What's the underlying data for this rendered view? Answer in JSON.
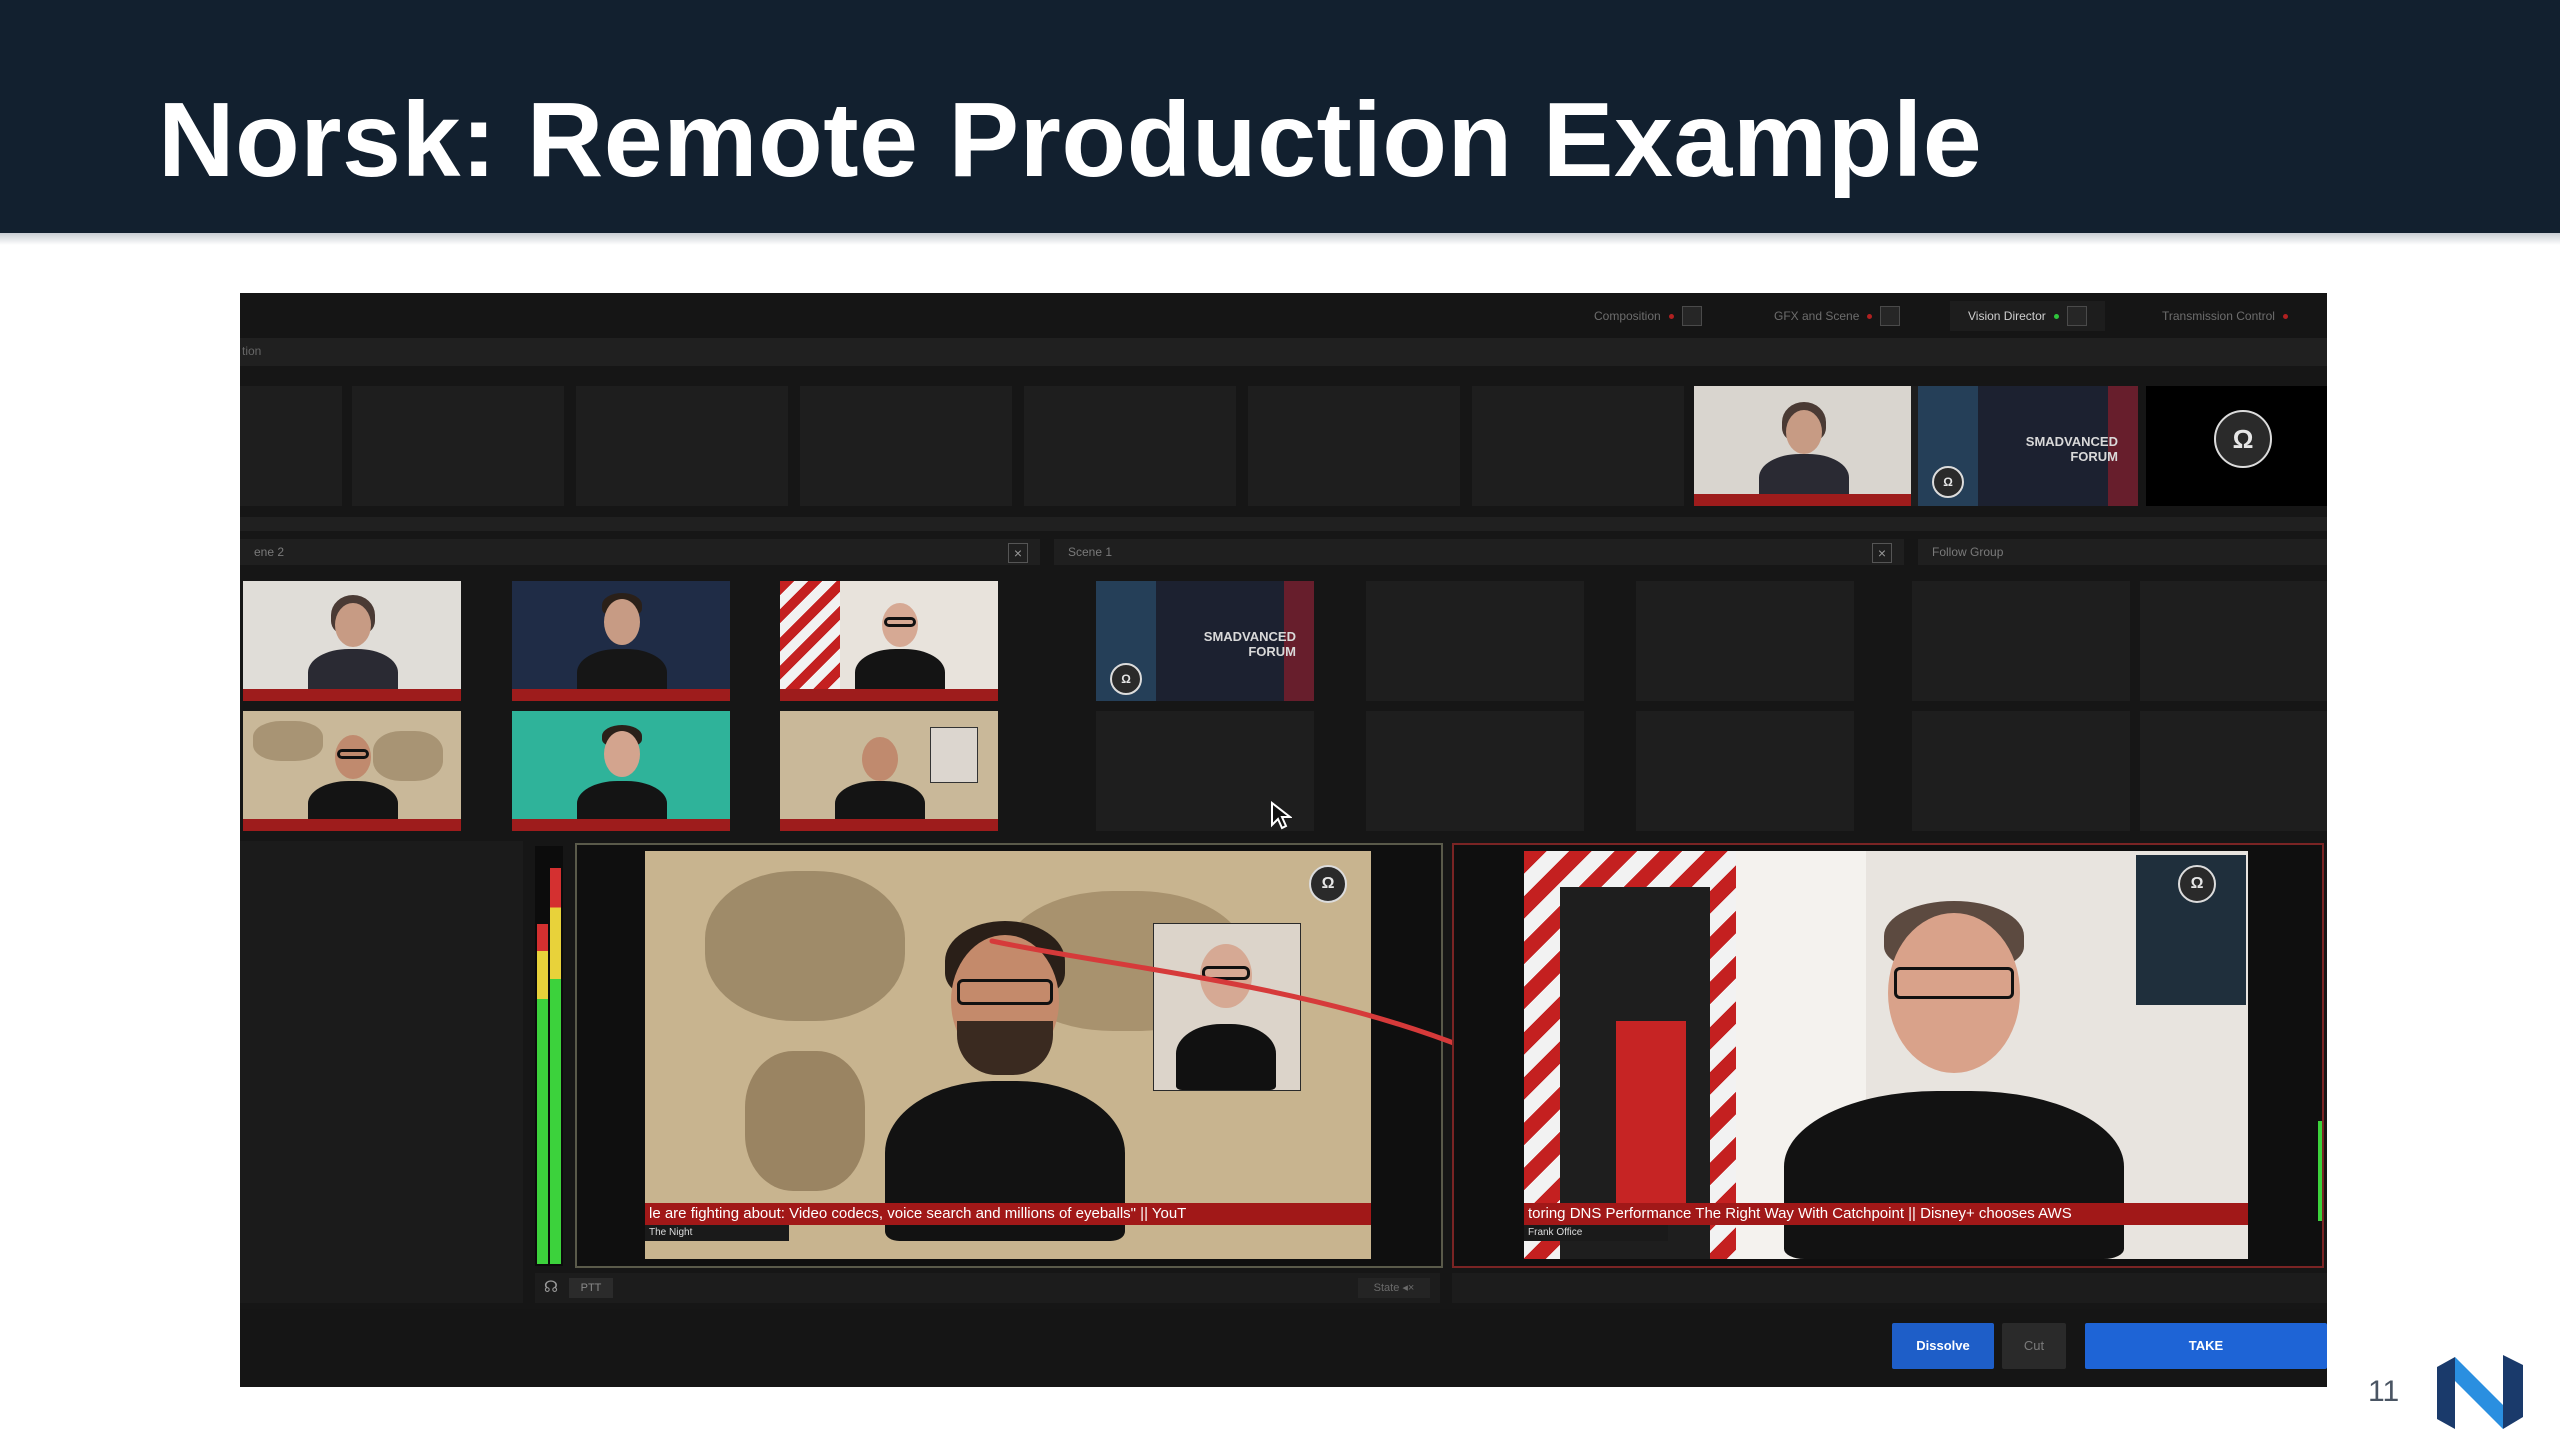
{
  "slide": {
    "title": "Norsk: Remote Production Example",
    "page_number": "11"
  },
  "app": {
    "tabs": [
      {
        "label": "Composition",
        "active": false
      },
      {
        "label": "GFX and Scene",
        "active": false
      },
      {
        "label": "Vision Director",
        "active": true
      },
      {
        "label": "Transmission Control",
        "active": false
      }
    ],
    "strip_label": "tion",
    "panes": {
      "scene2": "ene 2",
      "scene1": "Scene 1",
      "follow": "Follow Group"
    },
    "tile_text": "SMADVANCED FORUM",
    "preview_ticker": "le are fighting about: Video codecs, voice search and millions of eyeballs\"   ||   YouT",
    "preview_lower": "The Night",
    "program_ticker": "toring DNS Performance The Right Way With Catchpoint   ||   Disney+ chooses AWS",
    "program_lower": "Frank Office",
    "ptt_label": "PTT",
    "state_label": "State",
    "buttons": {
      "dissolve": "Dissolve",
      "cut": "Cut",
      "take": "TAKE"
    },
    "colors": {
      "take_button": "#1e64d6",
      "dissolve_button": "#1e5ec8",
      "ticker_red": "#a11818",
      "annotation_red": "#d63a3a"
    }
  }
}
